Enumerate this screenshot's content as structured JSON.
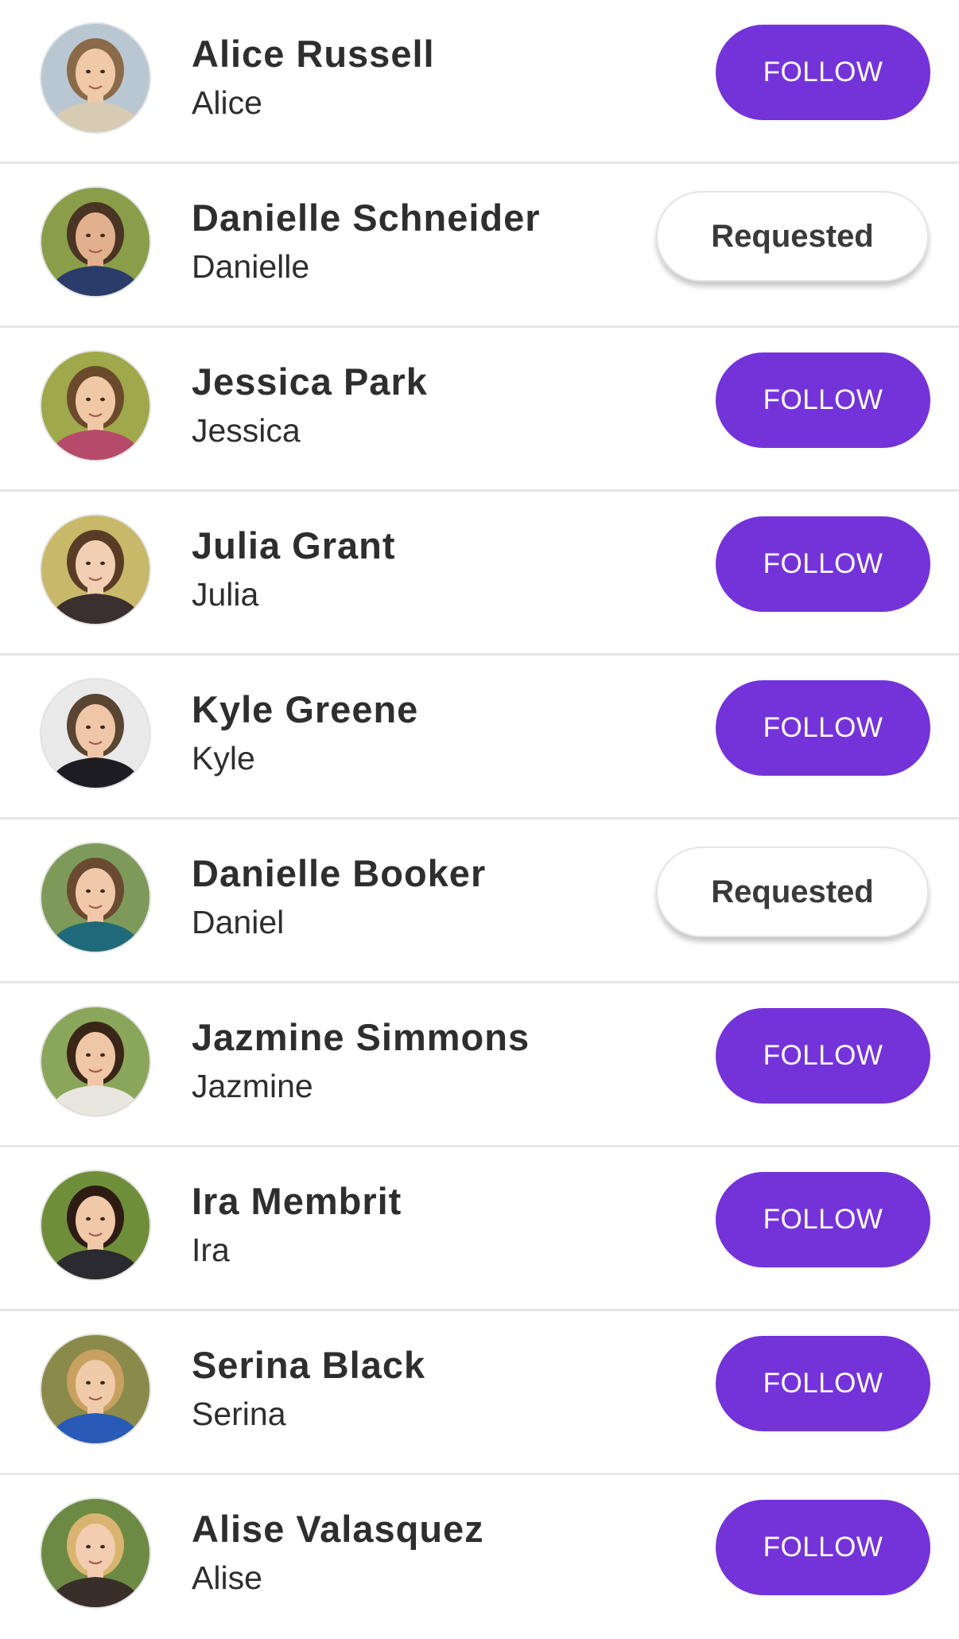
{
  "people": [
    {
      "name": "Alice Russell",
      "handle": "Alice",
      "button": "FOLLOW",
      "state": "follow",
      "bg": "#b9c7d2",
      "skin": "#efc9a8",
      "hair": "#8a6a48",
      "cloth": "#d8cbb3"
    },
    {
      "name": "Danielle Schneider",
      "handle": "Danielle",
      "button": "Requested",
      "state": "requested",
      "bg": "#8a9e4a",
      "skin": "#e2b08d",
      "hair": "#4a3424",
      "cloth": "#2a3c6a"
    },
    {
      "name": "Jessica Park",
      "handle": "Jessica",
      "button": "FOLLOW",
      "state": "follow",
      "bg": "#9fa84a",
      "skin": "#f0c8a6",
      "hair": "#6b4a2c",
      "cloth": "#b64a6a"
    },
    {
      "name": "Julia Grant",
      "handle": "Julia",
      "button": "FOLLOW",
      "state": "follow",
      "bg": "#c8b86a",
      "skin": "#f2cfb2",
      "hair": "#5a3c26",
      "cloth": "#3a3030"
    },
    {
      "name": "Kyle Greene",
      "handle": "Kyle",
      "button": "FOLLOW",
      "state": "follow",
      "bg": "#e9e9e9",
      "skin": "#efc6a8",
      "hair": "#5a4432",
      "cloth": "#1c1c22"
    },
    {
      "name": "Danielle Booker",
      "handle": "Daniel",
      "button": "Requested",
      "state": "requested",
      "bg": "#7e9a5a",
      "skin": "#f1c9aa",
      "hair": "#6a4a30",
      "cloth": "#1f6a7a"
    },
    {
      "name": "Jazmine Simmons",
      "handle": "Jazmine",
      "button": "FOLLOW",
      "state": "follow",
      "bg": "#8aa65a",
      "skin": "#efc6a6",
      "hair": "#3a2618",
      "cloth": "#e9e6e0"
    },
    {
      "name": "Ira Membrit",
      "handle": "Ira",
      "button": "FOLLOW",
      "state": "follow",
      "bg": "#6f8e3a",
      "skin": "#f1c8a8",
      "hair": "#2e1c14",
      "cloth": "#2a2a30"
    },
    {
      "name": "Serina Black",
      "handle": "Serina",
      "button": "FOLLOW",
      "state": "follow",
      "bg": "#8a8a4a",
      "skin": "#f0cbaa",
      "hair": "#c8a060",
      "cloth": "#2a5ab8"
    },
    {
      "name": "Alise Valasquez",
      "handle": "Alise",
      "button": "FOLLOW",
      "state": "follow",
      "bg": "#6c8a44",
      "skin": "#f2cdb0",
      "hair": "#d8b470",
      "cloth": "#3a2e2a"
    }
  ]
}
